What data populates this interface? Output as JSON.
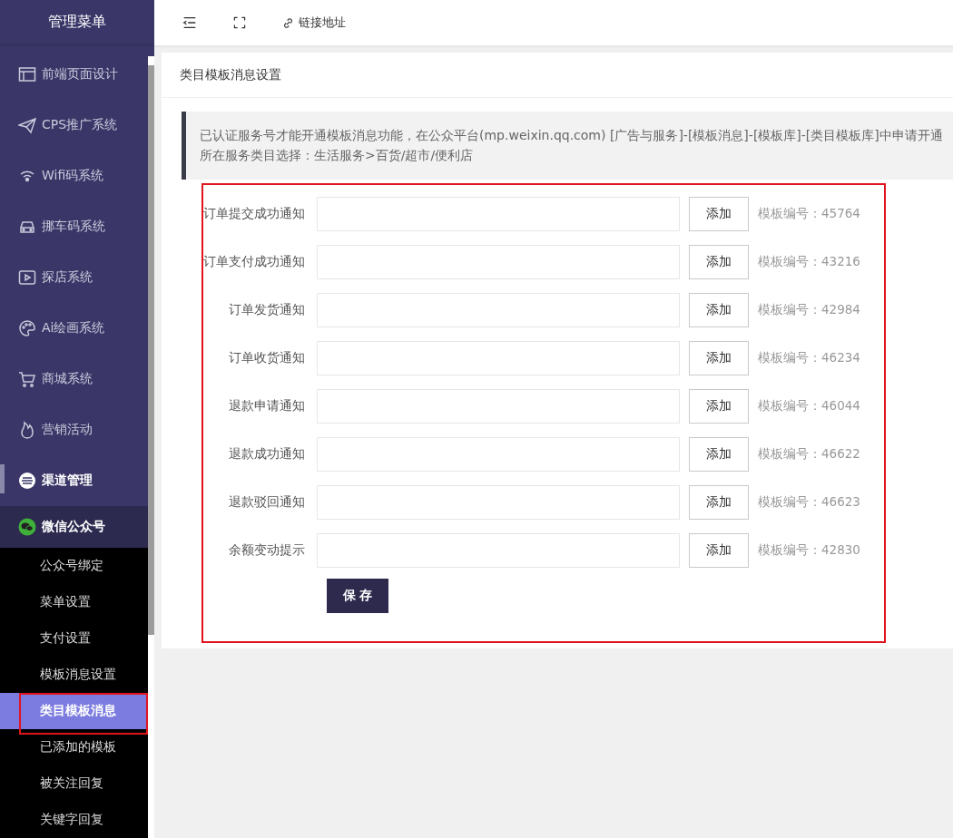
{
  "sidebar": {
    "title": "管理菜单",
    "items": [
      {
        "label": "前端页面设计",
        "active": false,
        "expanded": false
      },
      {
        "label": "CPS推广系统",
        "active": false,
        "expanded": false
      },
      {
        "label": "Wifi码系统",
        "active": false,
        "expanded": false
      },
      {
        "label": "挪车码系统",
        "active": false,
        "expanded": false
      },
      {
        "label": "探店系统",
        "active": false,
        "expanded": false
      },
      {
        "label": "Ai绘画系统",
        "active": false,
        "expanded": false
      },
      {
        "label": "商城系统",
        "active": false,
        "expanded": false
      },
      {
        "label": "营销活动",
        "active": false,
        "expanded": false
      },
      {
        "label": "渠道管理",
        "active": true,
        "expanded": false
      },
      {
        "label": "微信公众号",
        "active": false,
        "expanded": true,
        "children": [
          {
            "label": "公众号绑定",
            "selected": false
          },
          {
            "label": "菜单设置",
            "selected": false
          },
          {
            "label": "支付设置",
            "selected": false
          },
          {
            "label": "模板消息设置",
            "selected": false
          },
          {
            "label": "类目模板消息",
            "selected": true
          },
          {
            "label": "已添加的模板",
            "selected": false
          },
          {
            "label": "被关注回复",
            "selected": false
          },
          {
            "label": "关键字回复",
            "selected": false
          }
        ]
      }
    ]
  },
  "topbar": {
    "link": "链接地址"
  },
  "card": {
    "title": "类目模板消息设置",
    "notice": [
      "已认证服务号才能开通模板消息功能，在公众平台(mp.weixin.qq.com) [广告与服务]-[模板消息]-[模板库]-[类目模板库]中申请开通",
      "所在服务类目选择：生活服务>百货/超市/便利店"
    ],
    "rows": [
      {
        "label": "订单提交成功通知",
        "button": "添加",
        "hint": "模板编号：45764"
      },
      {
        "label": "订单支付成功通知",
        "button": "添加",
        "hint": "模板编号：43216"
      },
      {
        "label": "订单发货通知",
        "button": "添加",
        "hint": "模板编号：42984"
      },
      {
        "label": "订单收货通知",
        "button": "添加",
        "hint": "模板编号：46234"
      },
      {
        "label": "退款申请通知",
        "button": "添加",
        "hint": "模板编号：46044"
      },
      {
        "label": "退款成功通知",
        "button": "添加",
        "hint": "模板编号：46622"
      },
      {
        "label": "退款驳回通知",
        "button": "添加",
        "hint": "模板编号：46623"
      },
      {
        "label": "余额变动提示",
        "button": "添加",
        "hint": "模板编号：42830"
      }
    ],
    "save": "保 存"
  }
}
